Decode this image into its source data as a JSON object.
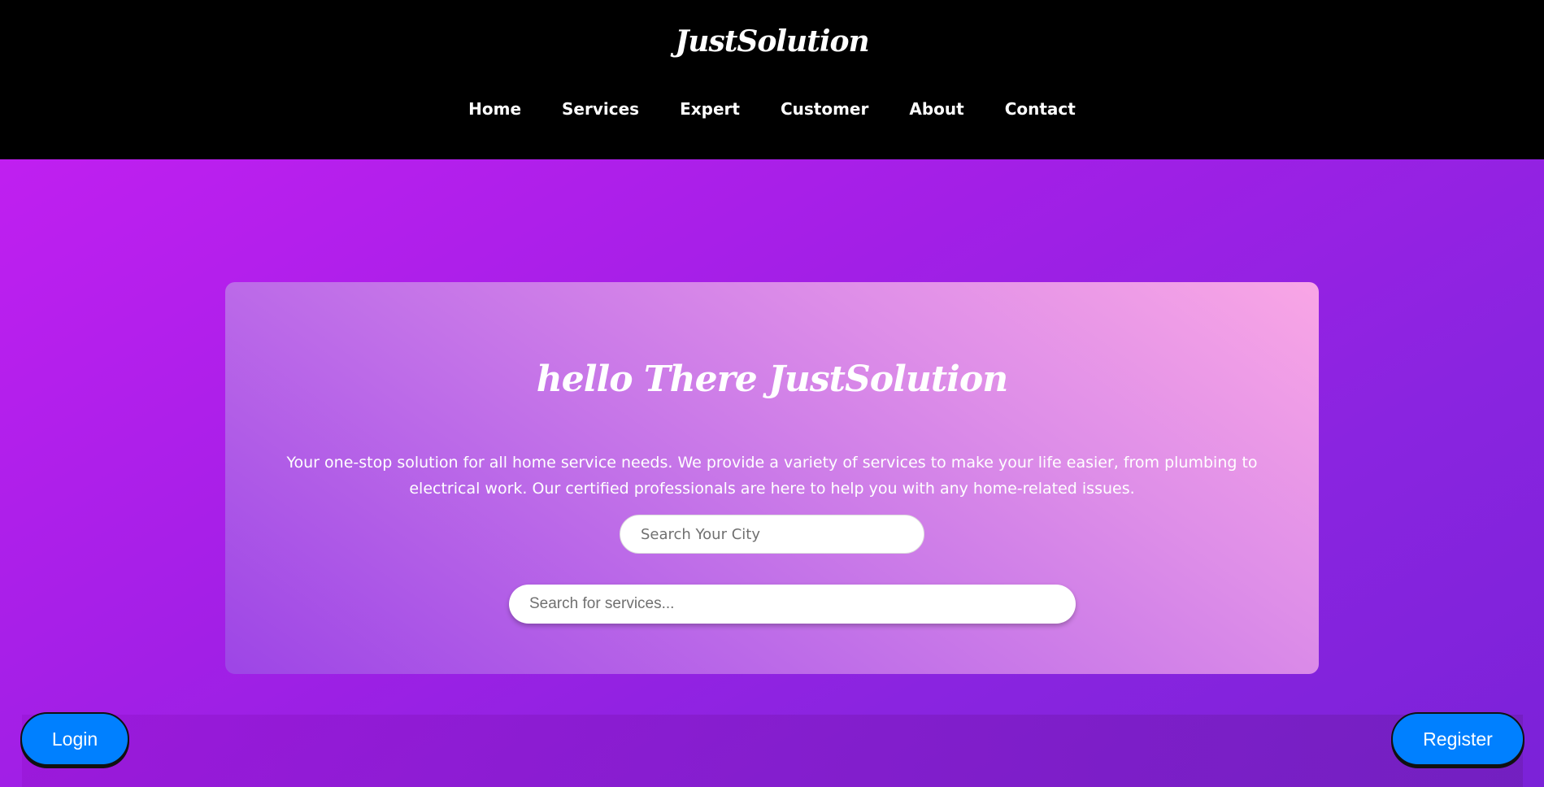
{
  "brand": {
    "name": "JustSolution"
  },
  "nav": {
    "items": [
      {
        "label": "Home"
      },
      {
        "label": "Services"
      },
      {
        "label": "Expert"
      },
      {
        "label": "Customer"
      },
      {
        "label": "About"
      },
      {
        "label": "Contact"
      }
    ]
  },
  "hero": {
    "heading": "hello There JustSolution",
    "description": "Your one-stop solution for all home service needs. We provide a variety of services to make your life easier, from plumbing to electrical work. Our certified professionals are here to help you with any home-related issues.",
    "city_search": {
      "placeholder": "Search Your City",
      "value": ""
    },
    "service_search": {
      "placeholder": "Search for services...",
      "value": ""
    }
  },
  "actions": {
    "login_label": "Login",
    "register_label": "Register"
  },
  "colors": {
    "header_bg": "#000000",
    "accent_button": "#0080ff",
    "hero_gradient_start": "#c01ff0",
    "hero_gradient_end": "#7b22d8"
  }
}
